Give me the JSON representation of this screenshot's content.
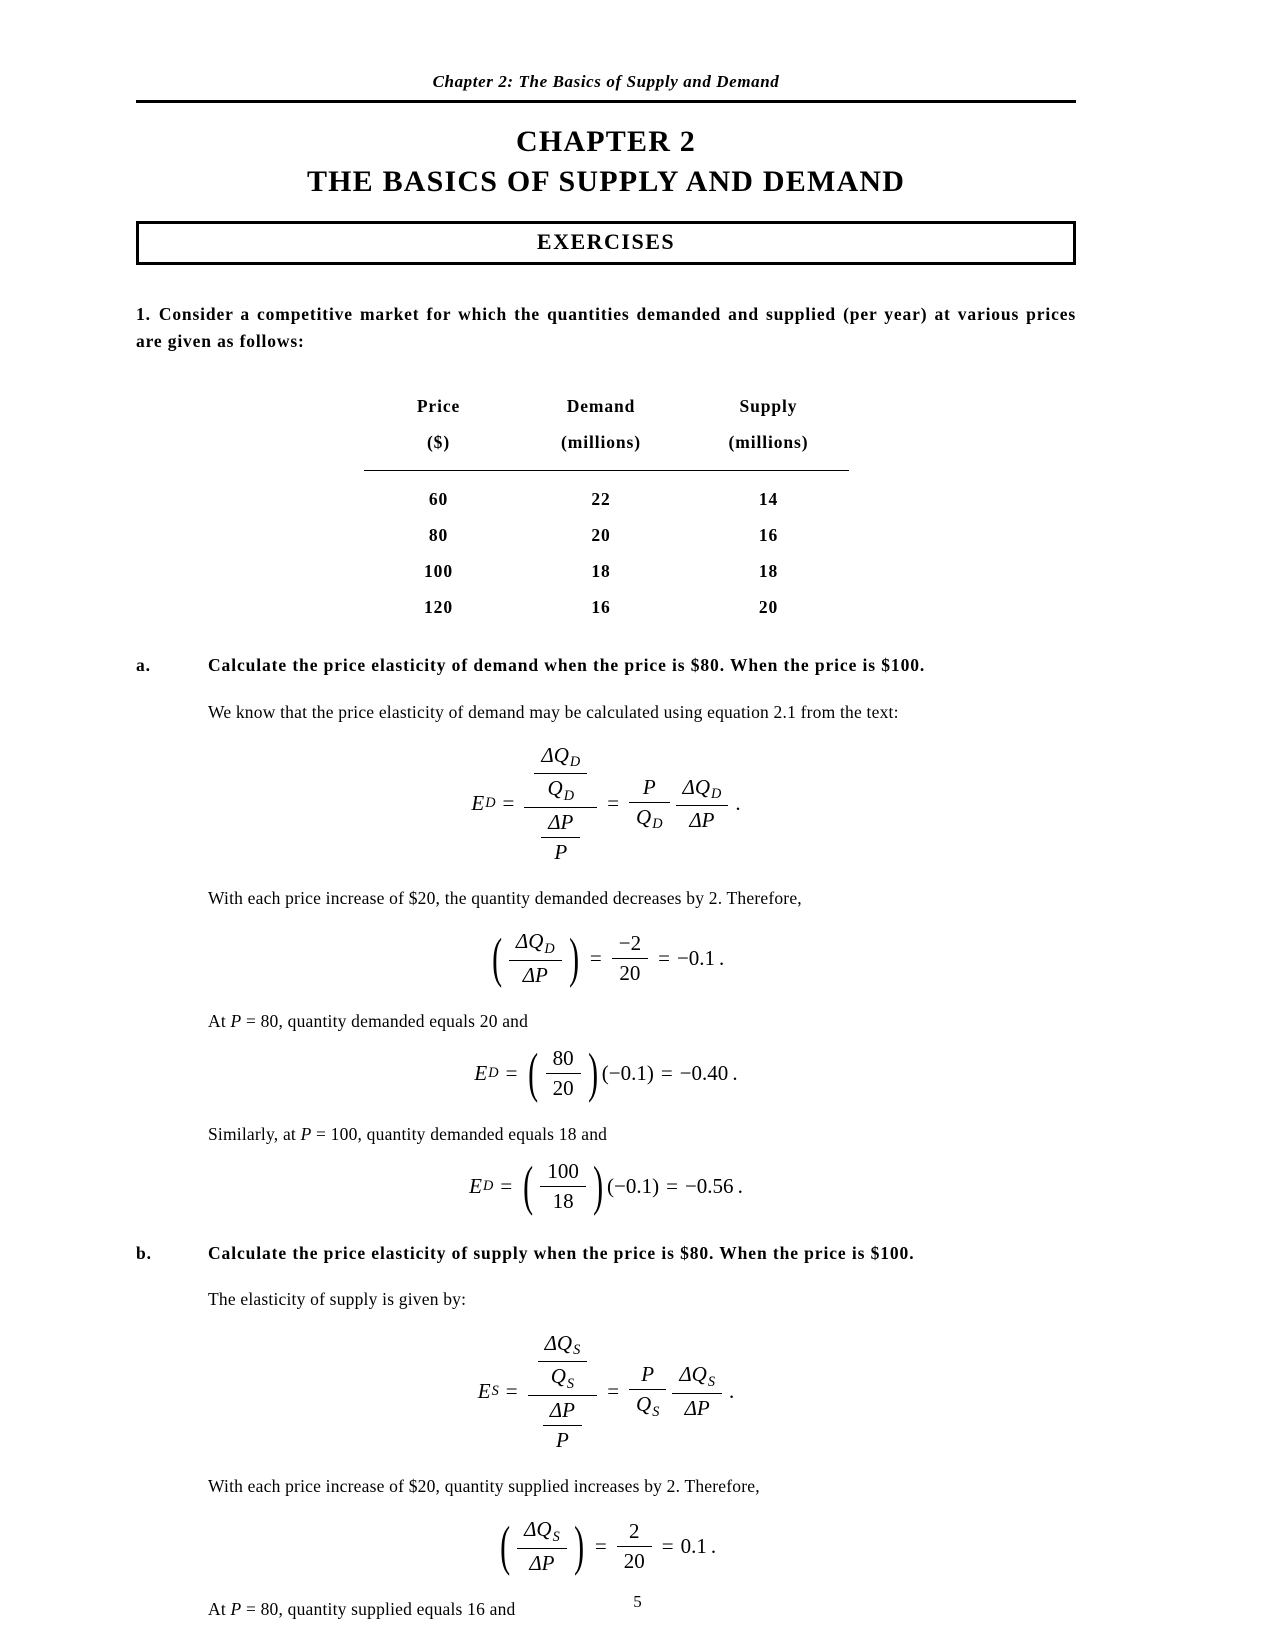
{
  "running_head": "Chapter 2: The Basics of Supply and Demand",
  "chapter": {
    "number": "CHAPTER 2",
    "title": "THE BASICS OF SUPPLY AND DEMAND"
  },
  "section_banner": "EXERCISES",
  "problem_1": {
    "number": "1.",
    "text": "Consider a competitive market for which the quantities demanded and supplied (per year) at various prices are given as follows:"
  },
  "table": {
    "headers": [
      "Price",
      "Demand",
      "Supply"
    ],
    "units": [
      "($)",
      "(millions)",
      "(millions)"
    ],
    "rows": [
      [
        "60",
        "22",
        "14"
      ],
      [
        "80",
        "20",
        "16"
      ],
      [
        "100",
        "18",
        "18"
      ],
      [
        "120",
        "16",
        "20"
      ]
    ]
  },
  "part_a": {
    "letter": "a.",
    "prompt": "Calculate the price elasticity of demand when the price is $80.  When the price is $100.",
    "p1_before": "We know that the price elasticity of demand may be calculated using equation 2.1 from the text:",
    "eq1": {
      "lhs_symbol": "E",
      "lhs_sub": "D",
      "equals": "=",
      "num_top": "ΔQ",
      "num_top_sub": "D",
      "num_bottom": "Q",
      "num_bottom_sub": "D",
      "den_top": "ΔP",
      "den_bottom": "P",
      "r_frac1_num": "P",
      "r_frac1_den": "Q",
      "r_frac1_den_sub": "D",
      "r_frac2_num": "ΔQ",
      "r_frac2_num_sub": "D",
      "r_frac2_den": "ΔP",
      "period": "."
    },
    "p2": "With each price increase of $20, the quantity demanded decreases by 2.  Therefore,",
    "eq2": {
      "paren_num": "ΔQ",
      "paren_num_sub": "D",
      "paren_den": "ΔP",
      "equals1": "=",
      "frac_num": "−2",
      "frac_den": "20",
      "equals2": "=",
      "result": "−0.1",
      "period": "."
    },
    "p3_pre": "At ",
    "p3_var": "P",
    "p3_post": " = 80, quantity demanded equals 20 and",
    "eq3": {
      "lhs_symbol": "E",
      "lhs_sub": "D",
      "equals1": "=",
      "frac_num": "80",
      "frac_den": "20",
      "factor": "(−0.1)",
      "equals2": "=",
      "result": "−0.40",
      "period": "."
    },
    "p4_pre": "Similarly, at ",
    "p4_var": "P",
    "p4_post": " = 100, quantity demanded equals 18 and",
    "eq4": {
      "lhs_symbol": "E",
      "lhs_sub": "D",
      "equals1": "=",
      "frac_num": "100",
      "frac_den": "18",
      "factor": "(−0.1)",
      "equals2": "=",
      "result": "−0.56",
      "period": "."
    }
  },
  "part_b": {
    "letter": "b.",
    "prompt": "Calculate the price elasticity of supply when the price is $80.  When the price is $100.",
    "p1": "The elasticity of supply is given by:",
    "eq1": {
      "lhs_symbol": "E",
      "lhs_sub": "S",
      "equals": "=",
      "num_top": "ΔQ",
      "num_top_sub": "S",
      "num_bottom": "Q",
      "num_bottom_sub": "S",
      "den_top": "ΔP",
      "den_bottom": "P",
      "r_frac1_num": "P",
      "r_frac1_den": "Q",
      "r_frac1_den_sub": "S",
      "r_frac2_num": "ΔQ",
      "r_frac2_num_sub": "S",
      "r_frac2_den": "ΔP",
      "period": "."
    },
    "p2": "With each price increase of $20, quantity supplied increases by 2.  Therefore,",
    "eq2": {
      "paren_num": "ΔQ",
      "paren_num_sub": "S",
      "paren_den": "ΔP",
      "equals1": "=",
      "frac_num": "2",
      "frac_den": "20",
      "equals2": "=",
      "result": "0.1",
      "period": "."
    },
    "p3_pre": "At ",
    "p3_var": "P",
    "p3_post": " = 80, quantity supplied equals 16 and"
  },
  "page_number": "5"
}
